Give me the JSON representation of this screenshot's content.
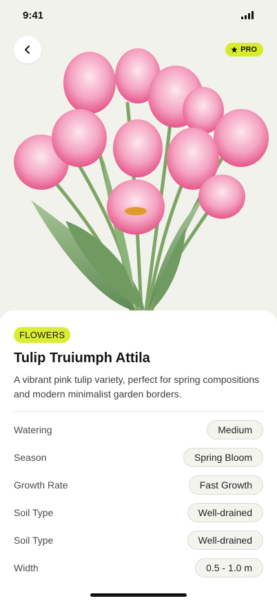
{
  "status_bar": {
    "time": "9:41",
    "signal_icon": "cellular-signal-icon"
  },
  "header": {
    "back_icon": "chevron-left-icon",
    "badge": {
      "label": "PRO",
      "icon": "star-icon",
      "color": "#d6ec2a"
    }
  },
  "hero": {
    "image_icon": "tulip-bouquet-image"
  },
  "plant": {
    "category": "FLOWERS",
    "name": "Tulip Truiumph Attila",
    "description": "A vibrant pink tulip variety, perfect for spring compositions and modern minimalist garden borders."
  },
  "properties": [
    {
      "label": "Watering",
      "value": "Medium"
    },
    {
      "label": "Season",
      "value": "Spring Bloom"
    },
    {
      "label": "Growth Rate",
      "value": "Fast Growth"
    },
    {
      "label": "Soil Type",
      "value": "Well-drained"
    },
    {
      "label": "Soil Type",
      "value": "Well-drained"
    },
    {
      "label": "Width",
      "value": "0.5 - 1.0 m"
    }
  ],
  "colors": {
    "accent": "#d9ee31",
    "tulip_pink": "#e8588f",
    "stem_green": "#7fa86a"
  }
}
